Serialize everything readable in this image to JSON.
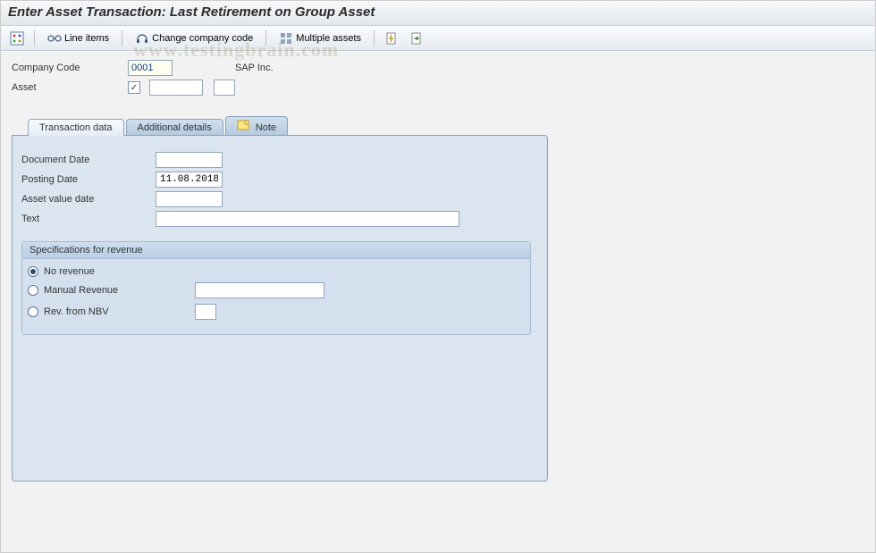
{
  "title": "Enter Asset Transaction: Last Retirement on Group Asset",
  "watermark": "www.testingbrain.com",
  "toolbar": {
    "line_items": "Line items",
    "change_cc": "Change company code",
    "multiple_assets": "Multiple assets"
  },
  "header": {
    "company_code_label": "Company Code",
    "company_code_value": "0001",
    "company_name": "SAP Inc.",
    "asset_label": "Asset",
    "asset_value": "",
    "subnumber_value": ""
  },
  "tabs": {
    "transaction_data": "Transaction data",
    "additional_details": "Additional details",
    "note": "Note"
  },
  "form": {
    "document_date_label": "Document Date",
    "document_date_value": "",
    "posting_date_label": "Posting Date",
    "posting_date_value": "11.08.2018",
    "asset_value_date_label": "Asset value date",
    "asset_value_date_value": "",
    "text_label": "Text",
    "text_value": ""
  },
  "revenue": {
    "groupbox_title": "Specifications for revenue",
    "no_revenue": "No revenue",
    "manual_revenue": "Manual Revenue",
    "manual_revenue_value": "",
    "rev_from_nbv": "Rev. from NBV",
    "rev_from_nbv_value": "",
    "selected": "no_revenue"
  }
}
